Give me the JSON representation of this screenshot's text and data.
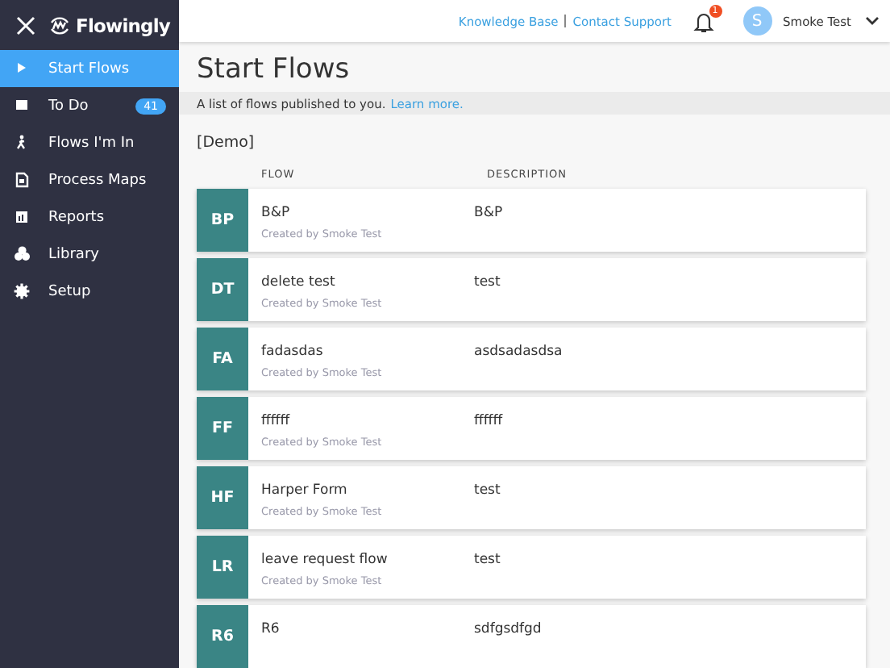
{
  "sidebar": {
    "logo": "Flowingly",
    "items": [
      {
        "label": "Start Flows",
        "selected": true
      },
      {
        "label": "To Do",
        "selected": false,
        "badge": "41"
      },
      {
        "label": "Flows I'm In",
        "selected": false
      },
      {
        "label": "Process Maps",
        "selected": false
      },
      {
        "label": "Reports",
        "selected": false
      },
      {
        "label": "Library",
        "selected": false
      },
      {
        "label": "Setup",
        "selected": false
      }
    ]
  },
  "header": {
    "links": [
      "Knowledge Base",
      "Contact Support"
    ],
    "notification_count": "1",
    "user": {
      "initial": "S",
      "name": "Smoke Test"
    }
  },
  "page": {
    "title": "Start Flows",
    "info": "A list of flows published to you.",
    "info_link": "Learn more.",
    "group": "[Demo]",
    "columns": [
      "FLOW",
      "DESCRIPTION"
    ],
    "rows": [
      {
        "initials": "BP",
        "name": "B&P",
        "created_by": "Created by Smoke Test",
        "description": "B&P"
      },
      {
        "initials": "DT",
        "name": "delete test",
        "created_by": "Created by Smoke Test",
        "description": "test"
      },
      {
        "initials": "FA",
        "name": "fadasdas",
        "created_by": "Created by Smoke Test",
        "description": "asdsadasdsa"
      },
      {
        "initials": "FF",
        "name": "ffffff",
        "created_by": "Created by Smoke Test",
        "description": "ffffff"
      },
      {
        "initials": "HF",
        "name": "Harper Form",
        "created_by": "Created by Smoke Test",
        "description": "test"
      },
      {
        "initials": "LR",
        "name": "leave request flow",
        "created_by": "Created by Smoke Test",
        "description": "test"
      },
      {
        "initials": "R6",
        "name": "R6",
        "description": "sdfgsdfgd"
      }
    ]
  }
}
